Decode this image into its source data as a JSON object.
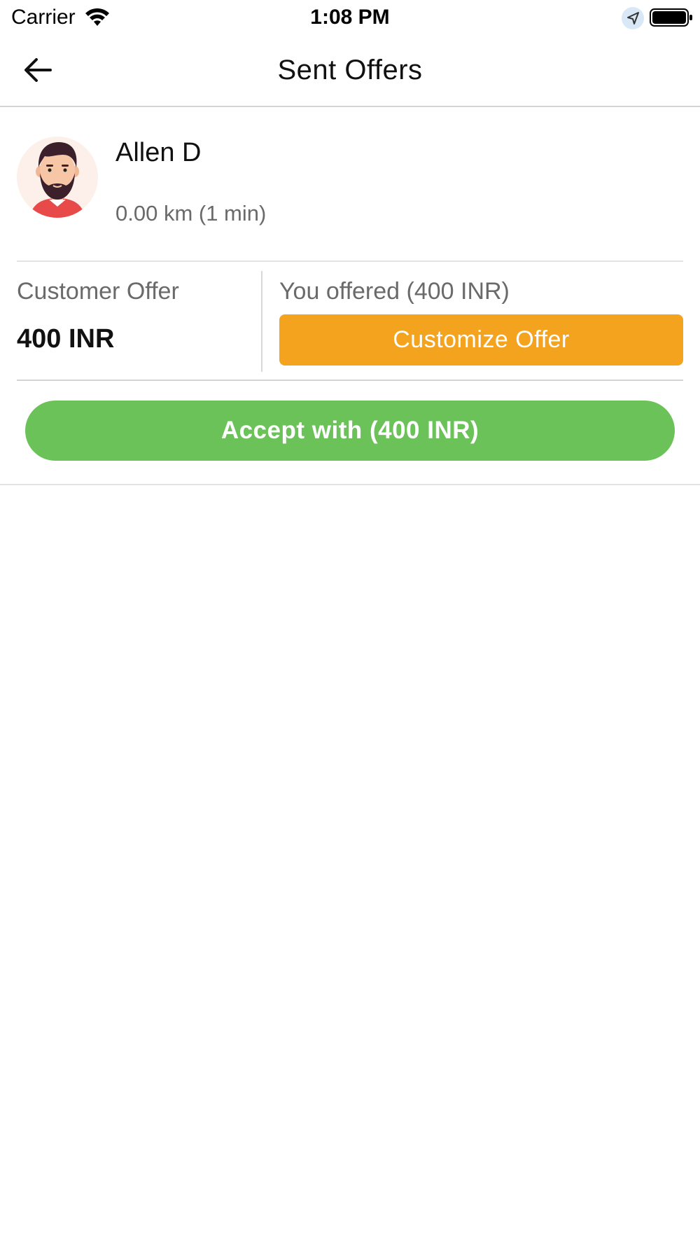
{
  "status_bar": {
    "carrier": "Carrier",
    "time": "1:08 PM",
    "icons": [
      "wifi-icon",
      "location-arrow-icon",
      "battery-icon"
    ]
  },
  "header": {
    "title": "Sent Offers",
    "back_icon": "arrow-left-icon"
  },
  "offer": {
    "rider_name": "Allen D",
    "distance": "0.00 km (1 min)",
    "avatar_icon": "bearded-man-avatar",
    "customer_offer_label": "Customer Offer",
    "customer_offer_value": "400 INR",
    "you_offered_label": "You offered (400 INR)",
    "customize_label": "Customize Offer",
    "accept_label": "Accept with (400 INR)"
  },
  "colors": {
    "customize_button": "#f4a31f",
    "accept_button": "#6ac259",
    "secondary_text": "#6a6a6a",
    "divider": "#d4d4d4"
  }
}
